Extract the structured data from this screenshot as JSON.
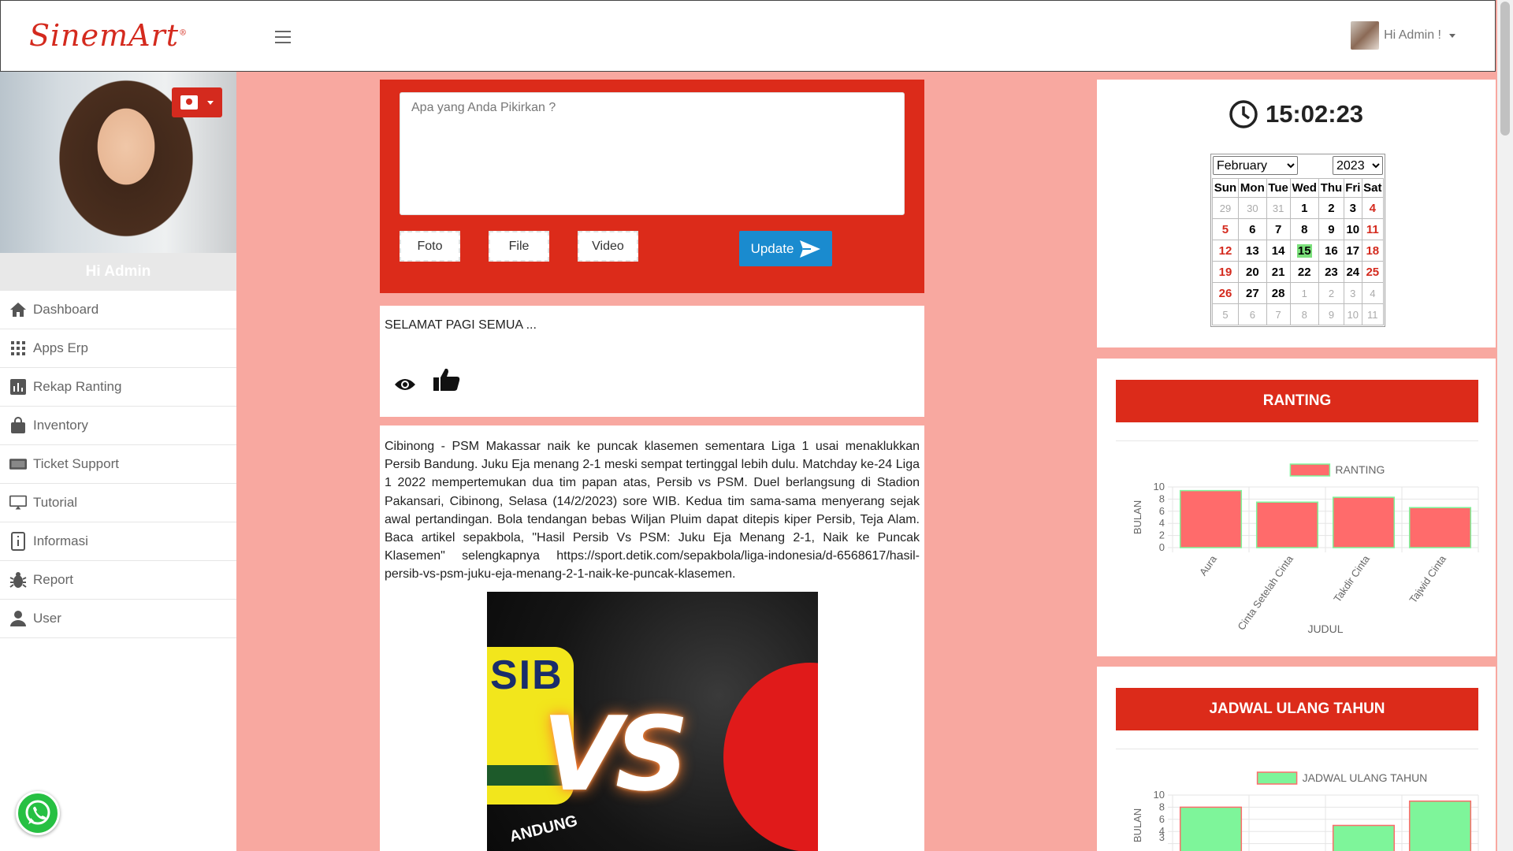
{
  "header": {
    "logo": "SinemArt",
    "user_label": "Hi Admin !"
  },
  "sidebar": {
    "greeting": "Hi Admin",
    "items": [
      {
        "label": "Dashboard",
        "icon": "home-icon"
      },
      {
        "label": "Apps Erp",
        "icon": "grid-icon"
      },
      {
        "label": "Rekap Ranting",
        "icon": "bar-chart-icon"
      },
      {
        "label": "Inventory",
        "icon": "shopping-bag-icon"
      },
      {
        "label": "Ticket Support",
        "icon": "ticket-icon"
      },
      {
        "label": "Tutorial",
        "icon": "monitor-icon"
      },
      {
        "label": "Informasi",
        "icon": "info-icon"
      },
      {
        "label": "Report",
        "icon": "bug-icon"
      },
      {
        "label": "User",
        "icon": "user-icon"
      }
    ]
  },
  "composer": {
    "placeholder": "Apa yang Anda Pikirkan ?",
    "foto_label": "Foto",
    "file_label": "File",
    "video_label": "Video",
    "update_label": "Update"
  },
  "greeting_post": {
    "text": "SELAMAT PAGI SEMUA ..."
  },
  "article": {
    "text": "Cibinong - PSM Makassar naik ke puncak klasemen sementara Liga 1 usai menaklukkan Persib Bandung. Juku Eja menang 2-1 meski sempat tertinggal lebih dulu. Matchday ke-24 Liga 1 2022 mempertemukan dua tim papan atas, Persib vs PSM. Duel berlangsung di Stadion Pakansari, Cibinong, Selasa (14/2/2023) sore WIB. Kedua tim sama-sama menyerang sejak awal pertandingan. Bola tendangan bebas Wiljan Pluim dapat ditepis kiper Persib, Teja Alam. Baca artikel sepakbola, \"Hasil Persib Vs PSM: Juku Eja Menang 2-1, Naik ke Puncak Klasemen\" selengkapnya https://sport.detik.com/sepakbola/liga-indonesia/d-6568617/hasil-persib-vs-psm-juku-eja-menang-2-1-naik-ke-puncak-klasemen.",
    "image_text_left": "SIB",
    "image_text_vs": "VS",
    "image_text_bottom": "ANDUNG"
  },
  "clock": {
    "time": "15:02:23"
  },
  "calendar": {
    "month": "February",
    "year": "2023",
    "weekdays": [
      "Sun",
      "Mon",
      "Tue",
      "Wed",
      "Thu",
      "Fri",
      "Sat"
    ],
    "weeks": [
      [
        "29",
        "30",
        "31",
        "1",
        "2",
        "3",
        "4"
      ],
      [
        "5",
        "6",
        "7",
        "8",
        "9",
        "10",
        "11"
      ],
      [
        "12",
        "13",
        "14",
        "15",
        "16",
        "17",
        "18"
      ],
      [
        "19",
        "20",
        "21",
        "22",
        "23",
        "24",
        "25"
      ],
      [
        "26",
        "27",
        "28",
        "1",
        "2",
        "3",
        "4"
      ],
      [
        "5",
        "6",
        "7",
        "8",
        "9",
        "10",
        "11"
      ]
    ],
    "today": "15"
  },
  "colors": {
    "brand_red": "#dc2b1a",
    "page_bg": "#f8a8a0",
    "update_blue": "#1a8bcf",
    "ranting_bar": "#ff6b6b",
    "ulang_tahun_bar": "#7ef59a"
  },
  "chart_data": [
    {
      "type": "bar",
      "title": "RANTING",
      "legend": "RANTING",
      "xlabel": "JUDUL",
      "ylabel": "BULAN",
      "categories": [
        "Aura",
        "Cinta Setelah Cinta",
        "Takdir Cinta",
        "Tajwid Cinta"
      ],
      "values": [
        9.4,
        7.5,
        8.3,
        6.6
      ],
      "yticks": [
        "0",
        "2",
        "4",
        "6",
        "8",
        "10"
      ],
      "ylim": [
        0,
        10
      ]
    },
    {
      "type": "bar",
      "title": "JADWAL ULANG TAHUN",
      "legend": "JADWAL ULANG TAHUN",
      "ylabel": "BULAN",
      "values": [
        8,
        null,
        5,
        9
      ],
      "yticks": [
        "3",
        "4",
        "6",
        "8",
        "10"
      ],
      "ylim": [
        0,
        10
      ]
    }
  ]
}
